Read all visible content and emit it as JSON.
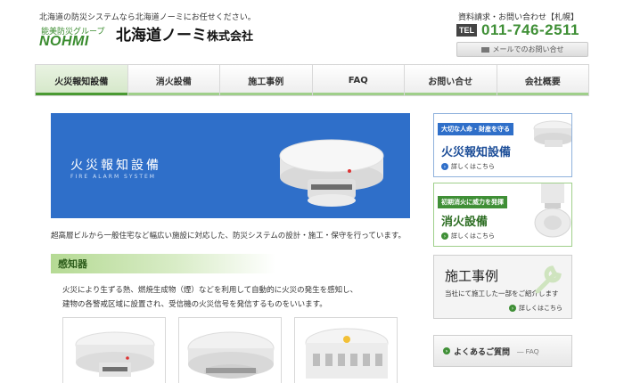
{
  "header": {
    "tagline": "北海道の防災システムなら北海道ノーミにお任せください。",
    "logo_group": "能美防災グループ",
    "logo_brand": "NOHMI",
    "company_name": "北海道ノーミ",
    "company_suffix": "株式会社",
    "contact_label": "資料請求・お問い合わせ【札幌】",
    "tel_badge": "TEL",
    "tel_number": "011-746-2511",
    "mail_button": "メールでのお問い合せ"
  },
  "nav": {
    "items": [
      {
        "label": "火災報知設備"
      },
      {
        "label": "消火設備"
      },
      {
        "label": "施工事例"
      },
      {
        "label": "FAQ"
      },
      {
        "label": "お問い合せ"
      },
      {
        "label": "会社概要"
      }
    ]
  },
  "hero": {
    "title": "火災報知設備",
    "subtitle": "FIRE ALARM SYSTEM"
  },
  "intro": "超高層ビルから一般住宅など幅広い施設に対応した、防災システムの設計・施工・保守を行っています。",
  "section": {
    "heading": "感知器",
    "description_line1": "火災により生ずる熱、燃焼生成物（煙）などを利用して自動的に火災の発生を感知し、",
    "description_line2": "建物の各警戒区域に設置され、受信機の火災信号を発信するものをいいます。"
  },
  "sidebar": {
    "card1": {
      "tag": "大切な人命・財産を守る",
      "title": "火災報知設備",
      "more": "詳しくはこちら"
    },
    "card2": {
      "tag": "初期消火に威力を発揮",
      "title": "消火設備",
      "more": "詳しくはこちら"
    },
    "card3": {
      "title": "施工事例",
      "text": "当社にて施工した一部をご紹介します",
      "more": "詳しくはこちら"
    },
    "faq": {
      "label": "よくあるご質問",
      "sub": "― FAQ"
    }
  },
  "colors": {
    "brand_green": "#3f8f36",
    "hero_blue": "#2f6fc9",
    "nav_active": "#d4e7c8"
  }
}
